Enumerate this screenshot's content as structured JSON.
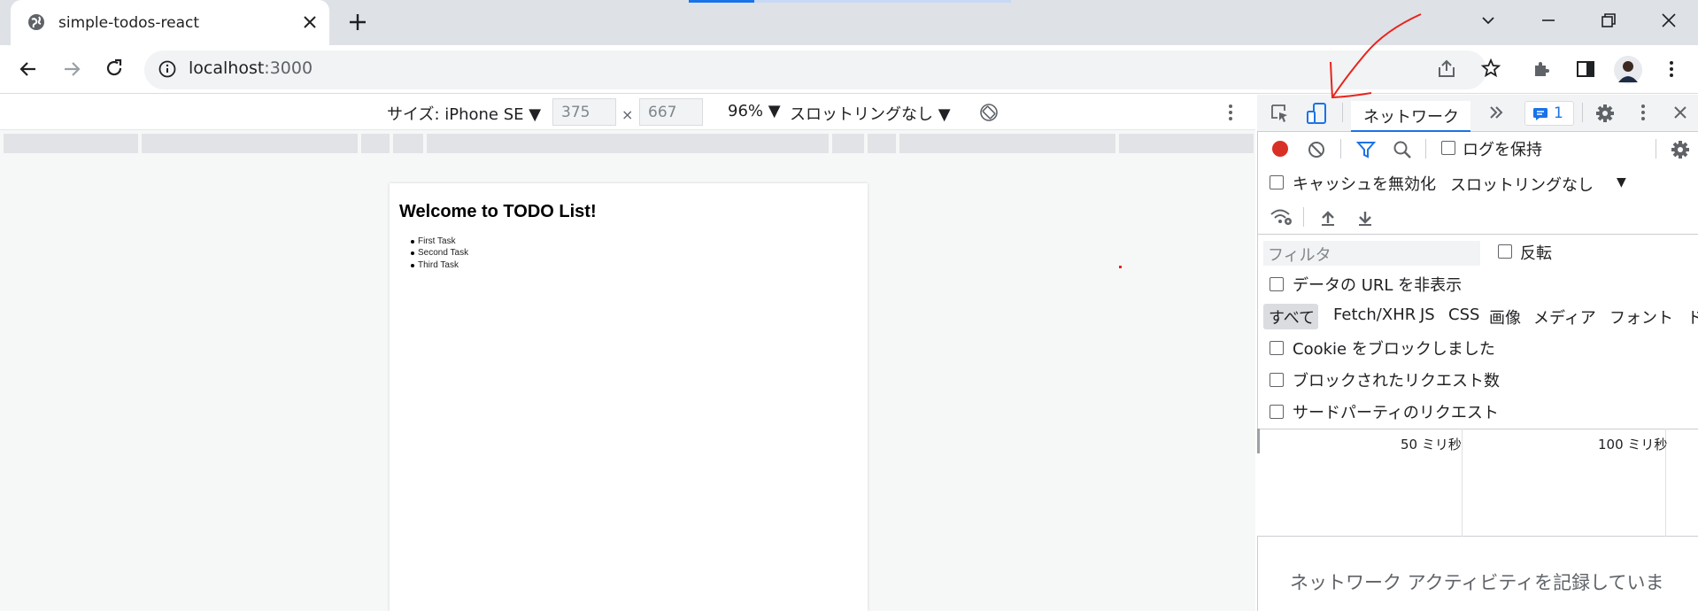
{
  "browser": {
    "tab_title": "simple-todos-react",
    "url_host": "localhost",
    "url_port": ":3000"
  },
  "device_toolbar": {
    "device_label": "サイズ: iPhone SE ▼",
    "width": "375",
    "x_sep": "×",
    "height": "667",
    "zoom": "96% ▼",
    "throttle": "スロットリングなし ▼"
  },
  "page": {
    "heading": "Welcome to TODO List!",
    "tasks": [
      "First Task",
      "Second Task",
      "Third Task"
    ]
  },
  "devtools": {
    "tab_network": "ネットワーク",
    "issues_count": "1",
    "preserve_log": "ログを保持",
    "disable_cache": "キャッシュを無効化",
    "throttling": "スロットリングなし",
    "filter_placeholder": "フィルタ",
    "invert": "反転",
    "hide_data_urls": "データの URL を非表示",
    "types": [
      "すべて",
      "Fetch/XHR",
      "JS",
      "CSS",
      "画像",
      "メディア",
      "フォント",
      "ド"
    ],
    "blocked_cookies": "Cookie をブロックしました",
    "blocked_requests": "ブロックされたリクエスト数",
    "third_party": "サードパーティのリクエスト",
    "timeline_50": "50 ミリ秒",
    "timeline_100": "100 ミリ秒",
    "empty_message": "ネットワーク アクティビティを記録していま"
  },
  "colors": {
    "accent": "#1a73e8",
    "record": "#d93025",
    "annotation": "#e8231c"
  }
}
